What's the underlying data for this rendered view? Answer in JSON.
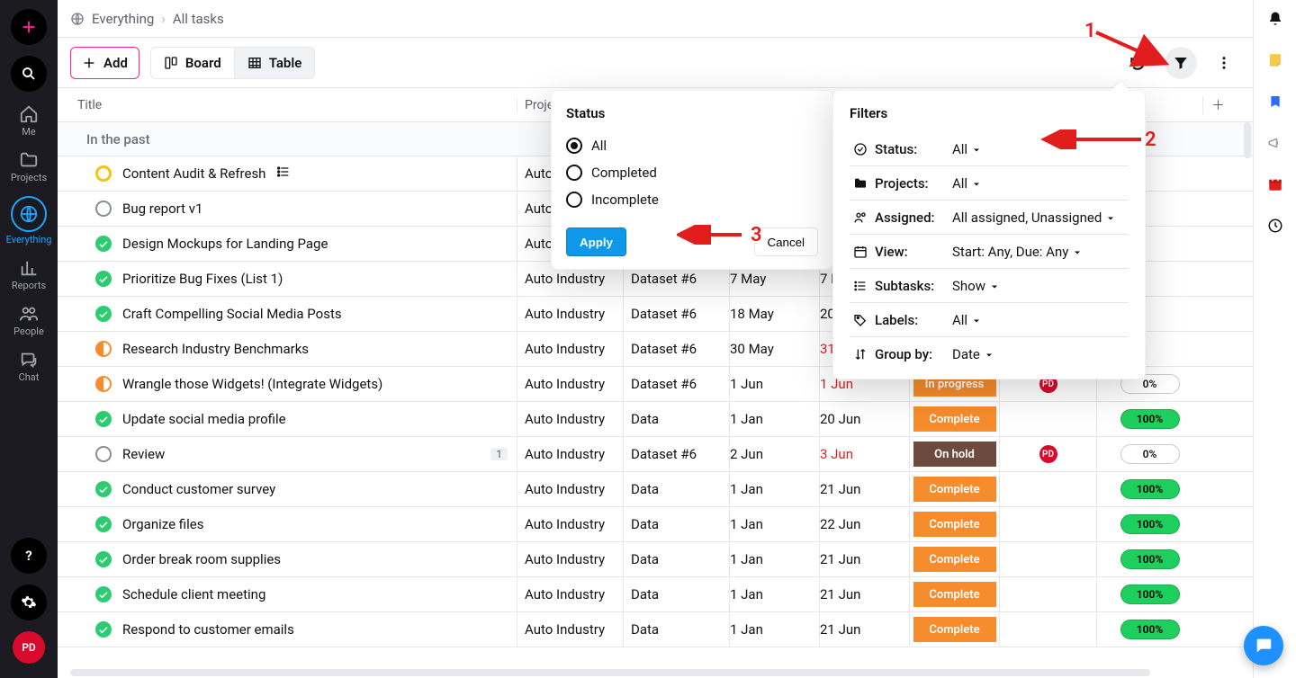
{
  "sidebarLeft": {
    "items": [
      {
        "name": "me",
        "label": "Me"
      },
      {
        "name": "projects",
        "label": "Projects"
      },
      {
        "name": "everything",
        "label": "Everything",
        "active": true
      },
      {
        "name": "reports",
        "label": "Reports"
      },
      {
        "name": "people",
        "label": "People"
      },
      {
        "name": "chat",
        "label": "Chat"
      }
    ],
    "avatar": "PD"
  },
  "crumbs": {
    "root": "Everything",
    "leaf": "All tasks",
    "sep": "›"
  },
  "toolbar": {
    "add": "Add",
    "board": "Board",
    "table": "Table"
  },
  "table": {
    "headers": {
      "title": "Title",
      "project": "Project",
      "plus": "＋"
    },
    "section": "In the past",
    "rows": [
      {
        "dot": "open",
        "title": "Content Audit & Refresh",
        "extra": "list",
        "project": "Auto Industry",
        "area": "",
        "d1": "",
        "d2": "",
        "status": "",
        "assignee": "",
        "pct": ""
      },
      {
        "dot": "hold",
        "title": "Bug report v1",
        "project": "Auto Industry",
        "area": "",
        "d1": "",
        "d2": "",
        "status": "",
        "assignee": "",
        "pct": ""
      },
      {
        "dot": "complete",
        "title": "Design Mockups for Landing Page",
        "project": "Auto Industry",
        "area": "",
        "d1": "",
        "d2": "",
        "status": "",
        "assignee": "",
        "pct": ""
      },
      {
        "dot": "complete",
        "title": "Prioritize Bug Fixes (List 1)",
        "project": "Auto Industry",
        "area": "Dataset #6",
        "d1": "7 May",
        "d2": "7 May",
        "status": "",
        "assignee": "",
        "pct": ""
      },
      {
        "dot": "complete",
        "title": "Craft Compelling Social Media Posts",
        "project": "Auto Industry",
        "area": "Dataset #6",
        "d1": "18 May",
        "d2": "20 May",
        "status": "",
        "assignee": "",
        "pct": ""
      },
      {
        "dot": "half",
        "title": "Research Industry Benchmarks",
        "project": "Auto Industry",
        "area": "Dataset #6",
        "d1": "30 May",
        "d2": "31 May",
        "d2red": true,
        "status": "",
        "assignee": "",
        "pct": ""
      },
      {
        "dot": "half",
        "title": "Wrangle those Widgets! (Integrate Widgets)",
        "project": "Auto Industry",
        "area": "Dataset #6",
        "d1": "1 Jun",
        "d2": "1 Jun",
        "d2red": true,
        "status": "In progress",
        "statusClass": "sb-ip",
        "assignee": "PD",
        "pct": "0%",
        "pctClass": "pct-0"
      },
      {
        "dot": "complete",
        "title": "Update social media profile",
        "project": "Auto Industry",
        "area": "Data",
        "d1": "1 Jan",
        "d2": "20 Jun",
        "status": "Complete",
        "statusClass": "sb-complete",
        "pct": "100%",
        "pctClass": "pct-100"
      },
      {
        "dot": "hold",
        "title": "Review",
        "count": "1",
        "project": "Auto Industry",
        "area": "Dataset #6",
        "d1": "2 Jun",
        "d2": "3 Jun",
        "d2red": true,
        "status": "On hold",
        "statusClass": "sb-hold",
        "assignee": "PD",
        "pct": "0%",
        "pctClass": "pct-0"
      },
      {
        "dot": "complete",
        "title": "Conduct customer survey",
        "project": "Auto Industry",
        "area": "Data",
        "d1": "1 Jan",
        "d2": "21 Jun",
        "status": "Complete",
        "statusClass": "sb-complete",
        "pct": "100%",
        "pctClass": "pct-100"
      },
      {
        "dot": "complete",
        "title": "Organize files",
        "project": "Auto Industry",
        "area": "Data",
        "d1": "1 Jan",
        "d2": "22 Jun",
        "status": "Complete",
        "statusClass": "sb-complete",
        "pct": "100%",
        "pctClass": "pct-100"
      },
      {
        "dot": "complete",
        "title": "Order break room supplies",
        "project": "Auto Industry",
        "area": "Data",
        "d1": "1 Jan",
        "d2": "21 Jun",
        "status": "Complete",
        "statusClass": "sb-complete",
        "pct": "100%",
        "pctClass": "pct-100"
      },
      {
        "dot": "complete",
        "title": "Schedule client meeting",
        "project": "Auto Industry",
        "area": "Data",
        "d1": "1 Jan",
        "d2": "21 Jun",
        "status": "Complete",
        "statusClass": "sb-complete",
        "pct": "100%",
        "pctClass": "pct-100"
      },
      {
        "dot": "complete",
        "title": "Respond to customer emails",
        "project": "Auto Industry",
        "area": "Data",
        "d1": "1 Jan",
        "d2": "21 Jun",
        "status": "Complete",
        "statusClass": "sb-complete",
        "pct": "100%",
        "pctClass": "pct-100"
      }
    ]
  },
  "statusPop": {
    "title": "Status",
    "opts": [
      "All",
      "Completed",
      "Incomplete"
    ],
    "selected": 0,
    "apply": "Apply",
    "cancel": "Cancel"
  },
  "filtersPop": {
    "title": "Filters",
    "rows": [
      {
        "icon": "check",
        "k": "Status:",
        "v": "All"
      },
      {
        "icon": "folder",
        "k": "Projects:",
        "v": "All"
      },
      {
        "icon": "user",
        "k": "Assigned:",
        "v": "All assigned, Unassigned"
      },
      {
        "icon": "cal",
        "k": "View:",
        "v": "Start: Any, Due: Any"
      },
      {
        "icon": "list",
        "k": "Subtasks:",
        "v": "Show"
      },
      {
        "icon": "tag",
        "k": "Labels:",
        "v": "All"
      },
      {
        "icon": "sort",
        "k": "Group by:",
        "v": "Date"
      }
    ]
  },
  "anno": {
    "n1": "1",
    "n2": "2",
    "n3": "3"
  }
}
